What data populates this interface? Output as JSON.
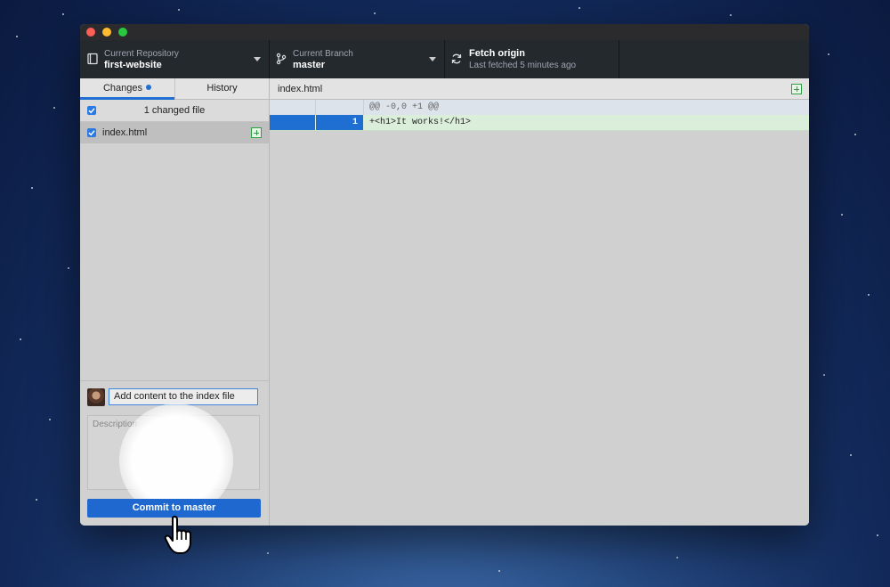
{
  "toolbar": {
    "repository": {
      "caption": "Current Repository",
      "name": "first-website"
    },
    "branch": {
      "caption": "Current Branch",
      "name": "master"
    },
    "fetch": {
      "title": "Fetch origin",
      "subtitle": "Last fetched 5 minutes ago"
    }
  },
  "sidebar": {
    "tabs": [
      {
        "label": "Changes"
      },
      {
        "label": "History"
      }
    ],
    "changed_count_label": "1 changed file",
    "files": [
      {
        "name": "index.html",
        "status": "added"
      }
    ]
  },
  "commit": {
    "summary_value": "Add content to the index file",
    "description_placeholder": "Description",
    "button_label": "Commit to master"
  },
  "diff": {
    "filename": "index.html",
    "hunk_header": "@@ -0,0 +1 @@",
    "lines": [
      {
        "old": "",
        "new": "1",
        "text": "+<h1>It works!</h1>"
      }
    ]
  },
  "colors": {
    "accent": "#1f6ed1",
    "toolbar": "#24292e",
    "added_line": "#dbeed9"
  },
  "icons": [
    "repository-icon",
    "branch-icon",
    "sync-icon",
    "checkbox-icon",
    "add-file-icon",
    "avatar",
    "hand-cursor-icon"
  ]
}
